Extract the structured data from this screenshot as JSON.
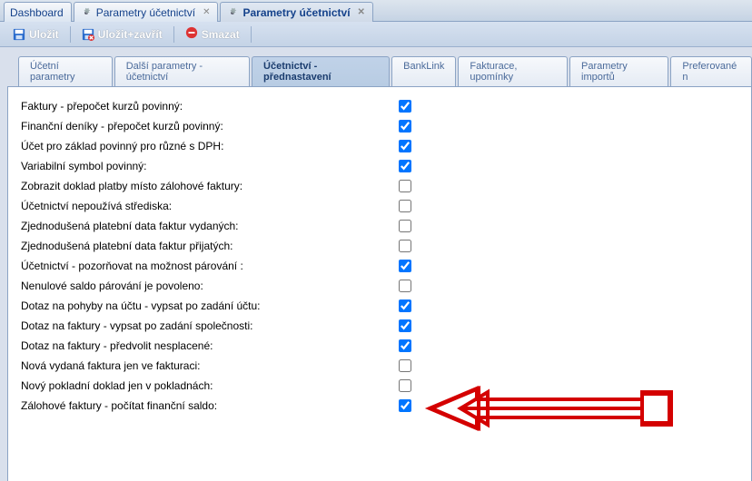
{
  "topTabs": {
    "items": [
      {
        "label": "Dashboard",
        "closable": false,
        "icon": "",
        "active": false
      },
      {
        "label": "Parametry účetnictví",
        "closable": true,
        "icon": "gear",
        "active": false
      },
      {
        "label": "Parametry účetnictví",
        "closable": true,
        "icon": "gear",
        "active": true
      }
    ]
  },
  "toolbar": {
    "save": "Uložit",
    "saveClose": "Uložit+zavřít",
    "delete": "Smazat"
  },
  "subtabs": {
    "items": [
      {
        "label": "Účetní parametry",
        "active": false
      },
      {
        "label": "Další parametry - účetnictví",
        "active": false
      },
      {
        "label": "Účetnictví - přednastavení",
        "active": true
      },
      {
        "label": "BankLink",
        "active": false
      },
      {
        "label": "Fakturace, upomínky",
        "active": false
      },
      {
        "label": "Parametry importů",
        "active": false
      },
      {
        "label": "Preferované n",
        "active": false
      }
    ]
  },
  "settings": [
    {
      "label": "Faktury - přepočet kurzů povinný:",
      "checked": true
    },
    {
      "label": "Finanční deníky - přepočet kurzů povinný:",
      "checked": true
    },
    {
      "label": "Účet pro základ povinný pro různé s DPH:",
      "checked": true
    },
    {
      "label": "Variabilní symbol povinný:",
      "checked": true
    },
    {
      "label": "Zobrazit doklad platby místo zálohové faktury:",
      "checked": false
    },
    {
      "label": "Účetnictví nepoužívá střediska:",
      "checked": false
    },
    {
      "label": "Zjednodušená platební data faktur vydaných:",
      "checked": false
    },
    {
      "label": "Zjednodušená platební data faktur přijatých:",
      "checked": false
    },
    {
      "label": "Účetnictví - pozorňovat na možnost párování :",
      "checked": true
    },
    {
      "label": "Nenulové saldo párování je povoleno:",
      "checked": false
    },
    {
      "label": "Dotaz na pohyby na účtu - vypsat po zadání účtu:",
      "checked": true
    },
    {
      "label": "Dotaz na faktury - vypsat po zadání společnosti:",
      "checked": true
    },
    {
      "label": "Dotaz na faktury - předvolit nesplacené:",
      "checked": true
    },
    {
      "label": "Nová vydaná faktura jen ve fakturaci:",
      "checked": false
    },
    {
      "label": "Nový pokladní doklad jen v pokladnách:",
      "checked": false
    },
    {
      "label": "Zálohové faktury - počítat finanční saldo:",
      "checked": true
    }
  ]
}
